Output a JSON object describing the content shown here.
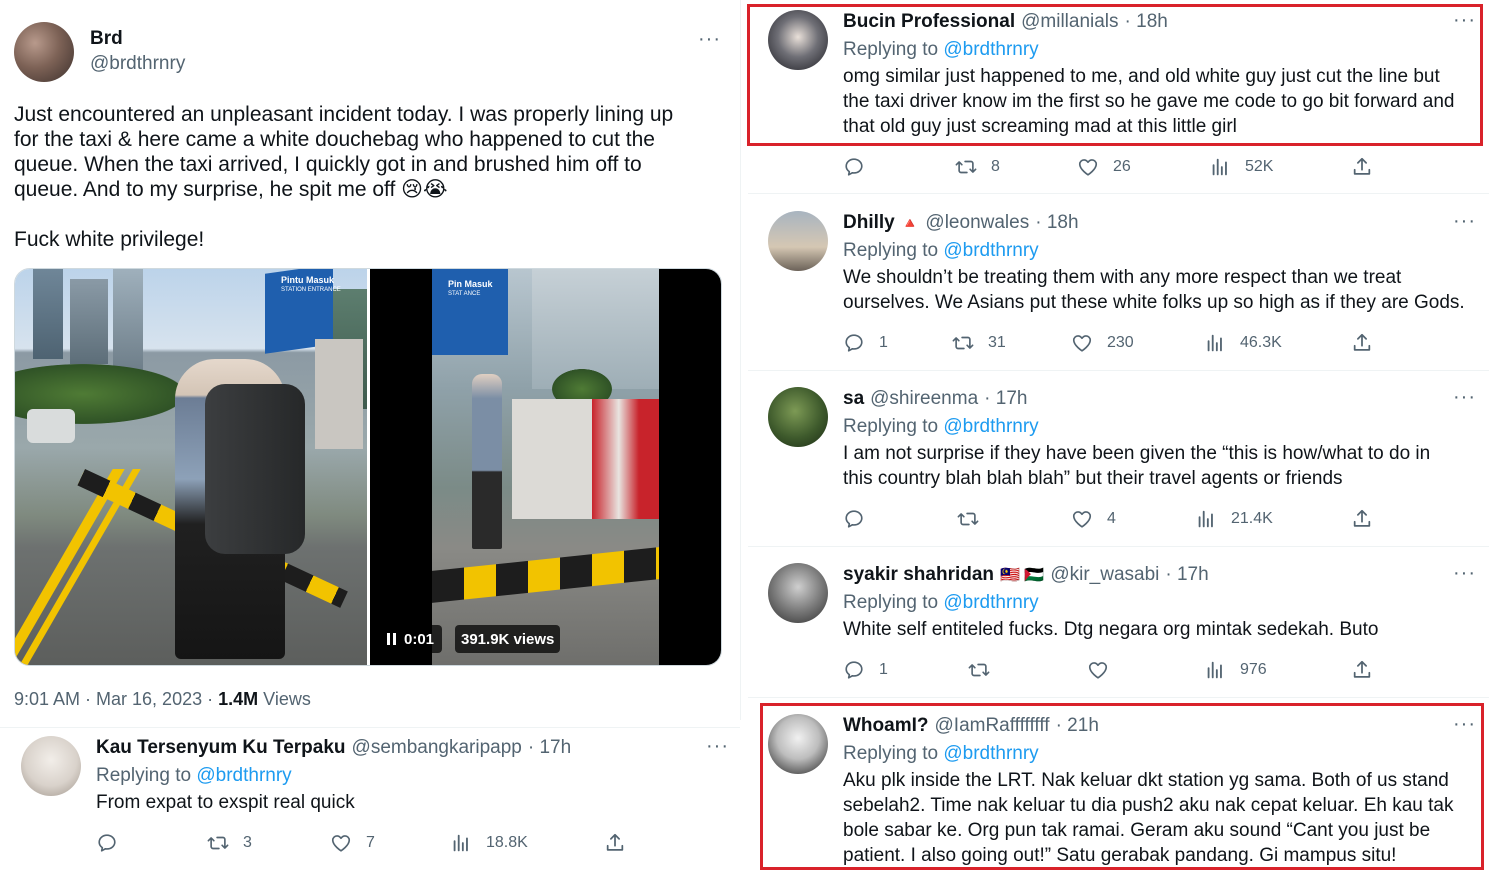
{
  "main_tweet": {
    "name": "Brd",
    "handle": "@brdthrnry",
    "text_lines": [
      "Just encountered an unpleasant incident today. I was properly lining up",
      "for the taxi & here came a white douchebag who happened to cut the",
      "queue. When the taxi arrived, I quickly got in and brushed him off to",
      "queue. And to my surprise, he spit me off 😢😭"
    ],
    "text_last": "Fuck white privilege!",
    "video": {
      "time": "0:01",
      "views": "391.9K views"
    },
    "timestamp": "9:01 AM · Mar 16, 2023 · ",
    "views_count": "1.4M",
    "views_label": " Views",
    "more": "···"
  },
  "replies": [
    {
      "name": "Kau Tersenyum Ku Terpaku",
      "handle": "@sembangkaripapp",
      "time": "· 17h",
      "replying_prefix": "Replying to ",
      "replying_to": "@brdthrnry",
      "text": "From expat to exspit real quick",
      "counts": {
        "reply": "",
        "retweet": "3",
        "like": "7",
        "views": "18.8K"
      }
    },
    {
      "name": "Bucin Professional",
      "handle": "@millanials",
      "time": "· 18h",
      "replying_prefix": "Replying to ",
      "replying_to": "@brdthrnry",
      "text_lines": [
        "omg similar just happened to me, and old white guy just cut the line but",
        "the taxi driver know im the first so he gave me code to go bit forward and",
        "that old guy just screaming mad at this little girl"
      ],
      "counts": {
        "reply": "",
        "retweet": "8",
        "like": "26",
        "views": "52K"
      }
    },
    {
      "name": "Dhilly",
      "badge": "🔺",
      "handle": "@leonwales",
      "time": "· 18h",
      "replying_prefix": "Replying to ",
      "replying_to": "@brdthrnry",
      "text_lines": [
        "We shouldn’t be treating them with any more respect than we treat",
        "ourselves. We Asians put these white folks up so high as if they are Gods."
      ],
      "counts": {
        "reply": "1",
        "retweet": "31",
        "like": "230",
        "views": "46.3K"
      }
    },
    {
      "name": "sa",
      "handle": "@shireenma",
      "time": "· 17h",
      "replying_prefix": "Replying to ",
      "replying_to": "@brdthrnry",
      "text_lines": [
        "I am not surprise if they have been given the “this is how/what to do in",
        "this country blah blah blah” but their travel agents or friends"
      ],
      "counts": {
        "reply": "",
        "retweet": "",
        "like": "4",
        "views": "21.4K"
      }
    },
    {
      "name": "syakir shahridan",
      "flags": "🇲🇾 🇵🇸",
      "handle": "@kir_wasabi",
      "time": "· 17h",
      "replying_prefix": "Replying to ",
      "replying_to": "@brdthrnry",
      "text": "White self entiteled fucks. Dtg negara org mintak sedekah. Buto",
      "counts": {
        "reply": "1",
        "retweet": "",
        "like": "",
        "views": "976"
      }
    },
    {
      "name": "WhoamI?",
      "handle": "@IamRaffffffff",
      "time": "· 21h",
      "replying_prefix": "Replying to ",
      "replying_to": "@brdthrnry",
      "text_lines": [
        "Aku plk inside the LRT. Nak keluar dkt station yg sama. Both of us stand",
        "sebelah2. Time nak keluar tu dia push2 aku nak cepat keluar. Eh kau tak",
        "bole sabar ke. Org pun tak ramai. Geram aku sound “Cant you just be",
        "patient. I also going out!” Satu gerabak pandang. Gi mampus situ!"
      ]
    }
  ],
  "photo_text": {
    "sign1": "Pintu Masuk",
    "sign1_sub": "STATION ENTRANCE",
    "sign2": "Pin  Masuk",
    "sign2_sub": "STAT  ANCE"
  },
  "colors": {
    "link": "#1d9bf0",
    "secondary": "#536471",
    "highlight": "#d9222a"
  },
  "icons": [
    "reply-icon",
    "retweet-icon",
    "like-icon",
    "views-icon",
    "share-icon",
    "more-icon",
    "pause-icon"
  ]
}
